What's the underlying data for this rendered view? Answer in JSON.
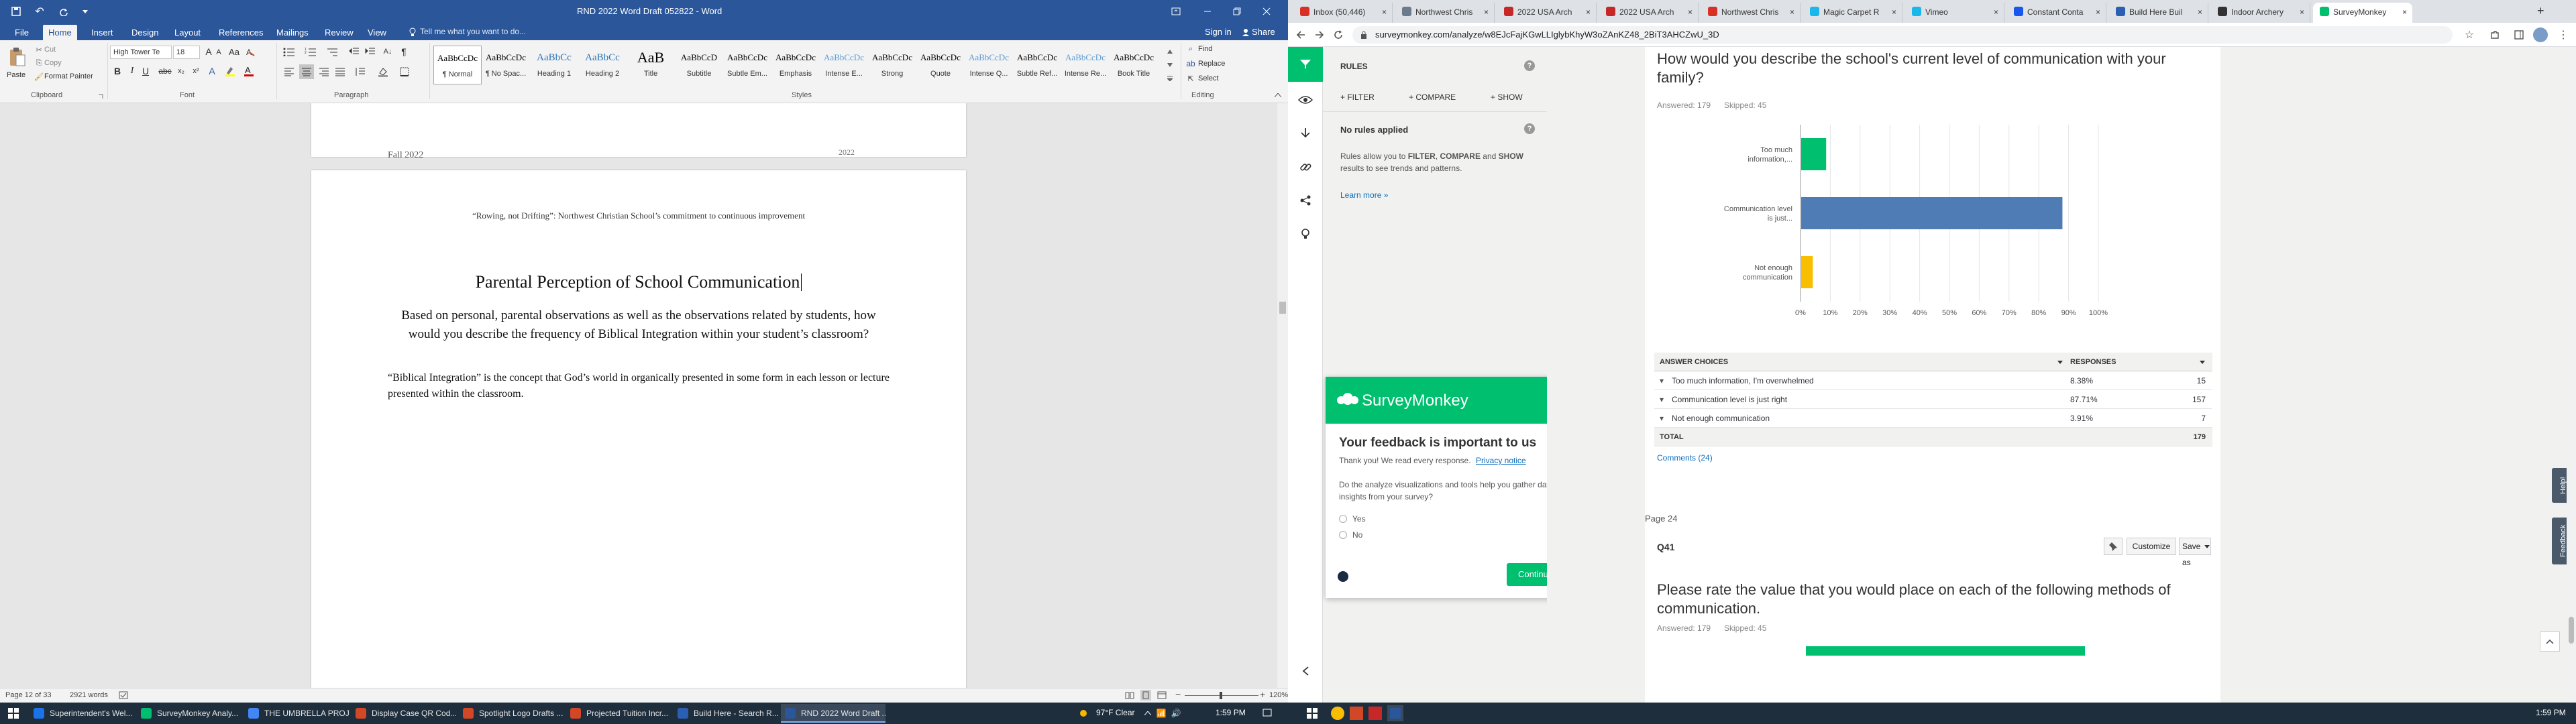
{
  "word": {
    "qat_undo": "↶",
    "window_title": "RND 2022 Word Draft 052822 - Word",
    "sign_in": "Sign in",
    "share": "Share",
    "tabs": [
      "File",
      "Home",
      "Insert",
      "Design",
      "Layout",
      "References",
      "Mailings",
      "Review",
      "View"
    ],
    "tell_me": "Tell me what you want to do...",
    "clipboard": {
      "paste": "Paste",
      "cut": "Cut",
      "copy": "Copy",
      "format_painter": "Format Painter",
      "label": "Clipboard"
    },
    "font": {
      "name": "High Tower Te",
      "size": "18",
      "label": "Font"
    },
    "paragraph_label": "Paragraph",
    "styles_label": "Styles",
    "styles": [
      {
        "sample": "AaBbCcDc",
        "name": "¶ Normal"
      },
      {
        "sample": "AaBbCcDc",
        "name": "¶ No Spac..."
      },
      {
        "sample": "AaBbCc",
        "name": "Heading 1"
      },
      {
        "sample": "AaBbCc",
        "name": "Heading 2"
      },
      {
        "sample": "AaB",
        "name": "Title"
      },
      {
        "sample": "AaBbCcD",
        "name": "Subtitle"
      },
      {
        "sample": "AaBbCcDc",
        "name": "Subtle Em..."
      },
      {
        "sample": "AaBbCcDc",
        "name": "Emphasis"
      },
      {
        "sample": "AaBbCcDc",
        "name": "Intense E..."
      },
      {
        "sample": "AaBbCcDc",
        "name": "Strong"
      },
      {
        "sample": "AaBbCcDc",
        "name": "Quote"
      },
      {
        "sample": "AaBbCcDc",
        "name": "Intense Q..."
      },
      {
        "sample": "AaBbCcDc",
        "name": "Subtle Ref..."
      },
      {
        "sample": "AaBbCcDc",
        "name": "Intense Re..."
      },
      {
        "sample": "AaBbCcDc",
        "name": "Book Title"
      }
    ],
    "editing": {
      "find": "Find",
      "replace": "Replace",
      "select": "Select",
      "label": "Editing"
    },
    "page_prev_footer": "Fall 2022",
    "page_prev_right": "2022",
    "doc_header": "“Rowing, not Drifting”:  Northwest Christian School’s commitment to continuous improvement",
    "doc_title": "Parental Perception of School Communication",
    "doc_question": "Based on personal, parental observations as well as the observations related by students, how would you describe the frequency of Biblical Integration within your student’s classroom?",
    "doc_note": "“Biblical Integration” is the concept that God’s world in organically presented in some form in each lesson or lecture presented within the classroom.",
    "status": {
      "page": "Page 12 of 33",
      "words": "2921 words",
      "zoom": "120%"
    }
  },
  "browser": {
    "tabs": [
      {
        "label": "Inbox (50,446)",
        "color": "#d93025"
      },
      {
        "label": "Northwest Chris",
        "color": "#6b7b8c"
      },
      {
        "label": "2022 USA Arch",
        "color": "#c62828"
      },
      {
        "label": "2022 USA Arch",
        "color": "#c62828"
      },
      {
        "label": "Northwest Chris",
        "color": "#d93025"
      },
      {
        "label": "Magic Carpet R",
        "color": "#1ab7ea"
      },
      {
        "label": "Vimeo",
        "color": "#1ab7ea"
      },
      {
        "label": "Constant Conta",
        "color": "#1856ed"
      },
      {
        "label": "Build Here Buil",
        "color": "#2b5fb4"
      },
      {
        "label": "Indoor Archery",
        "color": "#333333"
      },
      {
        "label": "SurveyMonkey",
        "color": "#00bf6f"
      }
    ],
    "new_tab": "+",
    "url": "surveymonkey.com/analyze/w8EJcFajKGwLLIglybKhyW3oZAnKZ48_2BiT3AHCZwU_3D"
  },
  "survey": {
    "rules": {
      "header": "RULES",
      "filter": "+ FILTER",
      "compare": "+ COMPARE",
      "show": "+ SHOW",
      "no_rules": "No rules applied",
      "desc_pre": "Rules allow you to ",
      "desc_filter": "FILTER",
      "desc_sep1": ", ",
      "desc_compare": "COMPARE",
      "desc_sep2": " and ",
      "desc_show": "SHOW",
      "desc_post": " results to see trends and patterns.",
      "learn_more": "Learn more »"
    },
    "feedback": {
      "brand": "SurveyMonkey",
      "heading": "Your feedback is important to us",
      "thanks": "Thank you! We read every response.",
      "privacy": "Privacy notice",
      "question": "Do the analyze visualizations and tools help you gather data insights from your survey?",
      "options": [
        "Yes",
        "No"
      ],
      "continue": "Continue"
    },
    "q1": {
      "title": "How would you describe the school's current level of communication with your family?",
      "answered": "Answered: 179",
      "skipped": "Skipped: 45",
      "table_headers": {
        "choices": "ANSWER CHOICES",
        "responses": "RESPONSES"
      },
      "rows": [
        {
          "label": "Too much information, I'm overwhelmed",
          "pct": "8.38%",
          "count": "15"
        },
        {
          "label": "Communication level is just right",
          "pct": "87.71%",
          "count": "157"
        },
        {
          "label": "Not enough communication",
          "pct": "3.91%",
          "count": "7"
        }
      ],
      "total_label": "TOTAL",
      "total": "179",
      "comments": "Comments (24)"
    },
    "page_label": "Page 24",
    "q2": {
      "id": "Q41",
      "customize": "Customize",
      "save_as": "Save as",
      "title": "Please rate the value that you would place on each of the following methods of communication.",
      "answered": "Answered: 179",
      "skipped": "Skipped: 45"
    },
    "side_tabs": {
      "help": "Help!",
      "feedback": "Feedback"
    }
  },
  "chart_data": {
    "type": "bar",
    "orientation": "horizontal",
    "categories": [
      "Too much information,...",
      "Communication level is just...",
      "Not enough communication"
    ],
    "values": [
      8.38,
      87.71,
      3.91
    ],
    "colors": [
      "#00bf6f",
      "#507cb6",
      "#f9be00"
    ],
    "xlim": [
      0,
      100
    ],
    "x_ticks": [
      "0%",
      "10%",
      "20%",
      "30%",
      "40%",
      "50%",
      "60%",
      "70%",
      "80%",
      "90%",
      "100%"
    ],
    "title": "",
    "xlabel": "",
    "ylabel": ""
  },
  "taskbar": {
    "items": [
      {
        "label": "Superintendent's Wel...",
        "color": "#1a73e8"
      },
      {
        "label": "SurveyMonkey Analy...",
        "color": "#00bf6f"
      },
      {
        "label": "THE UMBRELLA PROJ...",
        "color": "#4285f4"
      },
      {
        "label": "Display Case QR Cod...",
        "color": "#d24726"
      },
      {
        "label": "Spotlight Logo Drafts ...",
        "color": "#d24726"
      },
      {
        "label": "Projected Tuition Incr...",
        "color": "#d24726"
      },
      {
        "label": "Build Here - Search R...",
        "color": "#2b5fb4"
      },
      {
        "label": "RND 2022 Word Draft ...",
        "color": "#2b579a"
      }
    ],
    "weather": "97°F  Clear",
    "time": "1:59 PM",
    "time_right": "1:59 PM"
  }
}
